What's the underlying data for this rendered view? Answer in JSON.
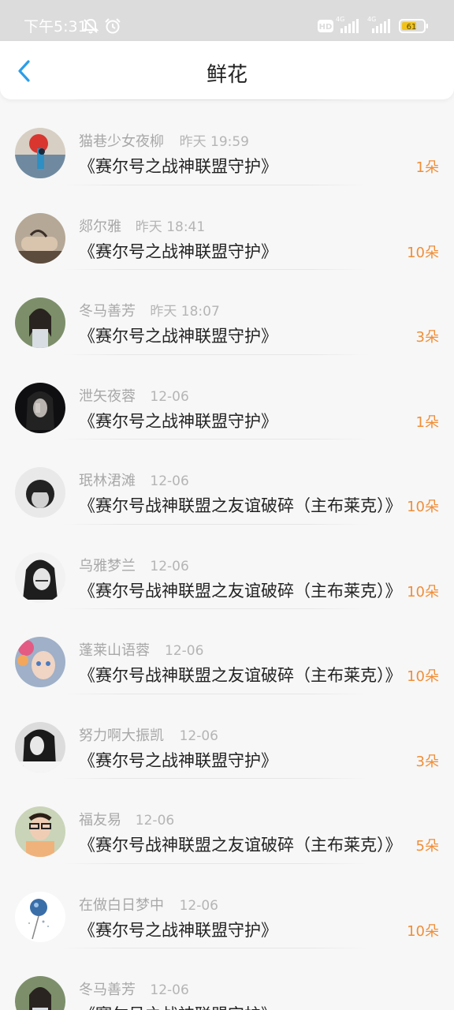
{
  "status_bar": {
    "time": "下午5:31",
    "icons": [
      "mute-bell-icon",
      "alarm-icon",
      "hd-icon",
      "signal-4g-icon",
      "signal-4g-icon",
      "battery-icon"
    ],
    "battery_level": "61"
  },
  "header": {
    "title": "鲜花",
    "back_icon": "chevron-left-icon"
  },
  "colors": {
    "accent": "#2b9ee8",
    "count": "#f08e37",
    "text": "#222222",
    "meta": "#a8a8a8"
  },
  "items": [
    {
      "name": "猫巷少女夜柳",
      "time": "昨天 19:59",
      "work": "《赛尔号之战神联盟守护》",
      "count": "1朵"
    },
    {
      "name": "郯尔雅",
      "time": "昨天 18:41",
      "work": "《赛尔号之战神联盟守护》",
      "count": "10朵"
    },
    {
      "name": "冬马善芳",
      "time": "昨天 18:07",
      "work": "《赛尔号之战神联盟守护》",
      "count": "3朵"
    },
    {
      "name": "泄矢夜蓉",
      "time": "12-06",
      "work": "《赛尔号之战神联盟守护》",
      "count": "1朵"
    },
    {
      "name": "珉林涒滩",
      "time": "12-06",
      "work": "《赛尔号战神联盟之友谊破碎（主布莱克）》",
      "count": "10朵"
    },
    {
      "name": "乌雅梦兰",
      "time": "12-06",
      "work": "《赛尔号战神联盟之友谊破碎（主布莱克）》",
      "count": "10朵"
    },
    {
      "name": "蓬莱山语蓉",
      "time": "12-06",
      "work": "《赛尔号战神联盟之友谊破碎（主布莱克）》",
      "count": "10朵"
    },
    {
      "name": "努力啊大振凯",
      "time": "12-06",
      "work": "《赛尔号之战神联盟守护》",
      "count": "3朵"
    },
    {
      "name": "福友易",
      "time": "12-06",
      "work": "《赛尔号战神联盟之友谊破碎（主布莱克）》",
      "count": "5朵"
    },
    {
      "name": "在做白日梦中",
      "time": "12-06",
      "work": "《赛尔号之战神联盟守护》",
      "count": "10朵"
    },
    {
      "name": "冬马善芳",
      "time": "12-06",
      "work": "《赛尔号之战神联盟守护》",
      "count": ""
    }
  ]
}
